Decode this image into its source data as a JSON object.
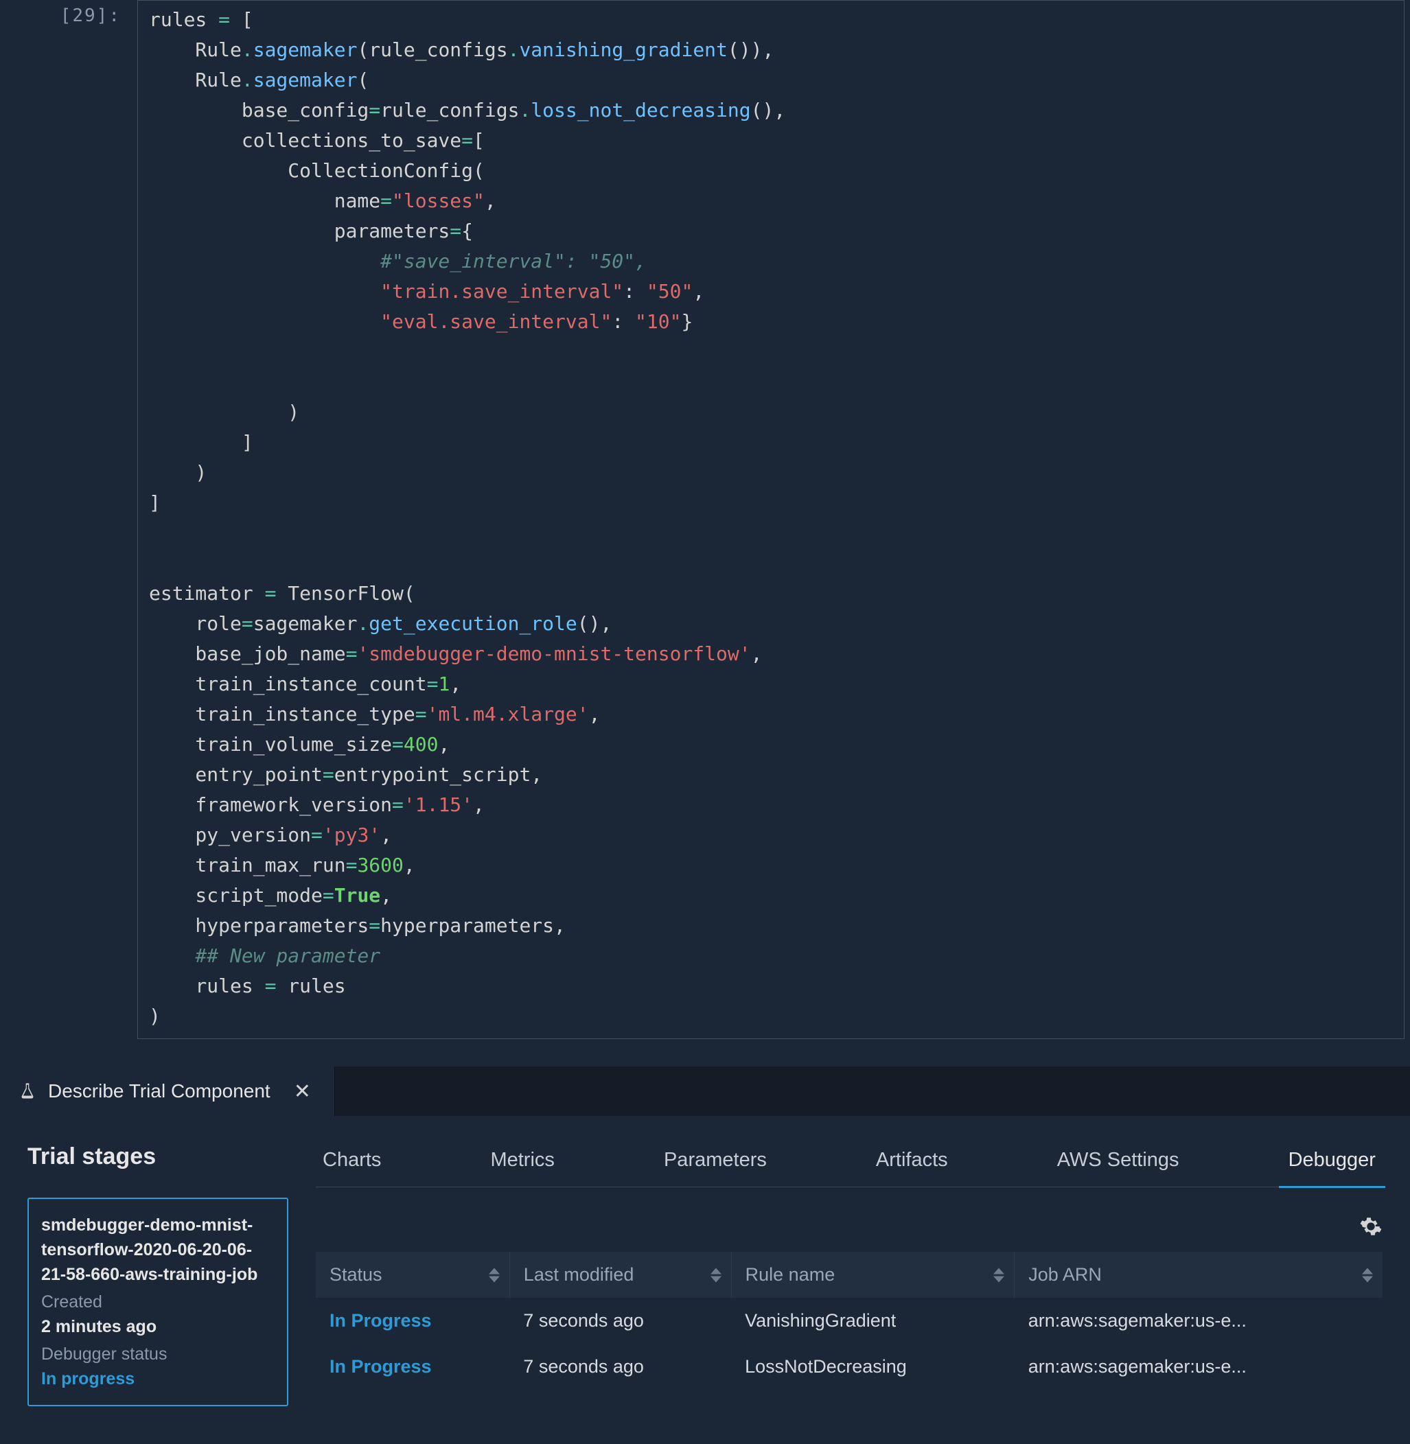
{
  "cell": {
    "prompt": "[29]:",
    "code": {
      "l1a": "rules ",
      "l1b": "=",
      "l1c": " [",
      "l2a": "    Rule",
      "l2b": ".",
      "l2c": "sagemaker",
      "l2d": "(rule_configs",
      "l2e": ".",
      "l2f": "vanishing_gradient",
      "l2g": "()),",
      "l3a": "    Rule",
      "l3b": ".",
      "l3c": "sagemaker",
      "l3d": "(",
      "l4a": "        base_config",
      "l4b": "=",
      "l4c": "rule_configs",
      "l4d": ".",
      "l4e": "loss_not_decreasing",
      "l4f": "(),",
      "l5a": "        collections_to_save",
      "l5b": "=",
      "l5c": "[",
      "l6a": "            CollectionConfig(",
      "l7a": "                name",
      "l7b": "=",
      "l7c": "\"losses\"",
      "l7d": ",",
      "l8a": "                parameters",
      "l8b": "=",
      "l8c": "{",
      "l9a": "                    #\"save_interval\": \"50\",",
      "l10a": "                    ",
      "l10b": "\"train.save_interval\"",
      "l10c": ": ",
      "l10d": "\"50\"",
      "l10e": ",",
      "l11a": "                    ",
      "l11b": "\"eval.save_interval\"",
      "l11c": ": ",
      "l11d": "\"10\"",
      "l11e": "}",
      "l12": "",
      "l13": "",
      "l14": "            )",
      "l15": "        ]",
      "l16": "    )",
      "l17": "]",
      "l18": "",
      "l19": "",
      "l20a": "estimator ",
      "l20b": "=",
      "l20c": " TensorFlow(",
      "l21a": "    role",
      "l21b": "=",
      "l21c": "sagemaker",
      "l21d": ".",
      "l21e": "get_execution_role",
      "l21f": "(),",
      "l22a": "    base_job_name",
      "l22b": "=",
      "l22c": "'smdebugger-demo-mnist-tensorflow'",
      "l22d": ",",
      "l23a": "    train_instance_count",
      "l23b": "=",
      "l23c": "1",
      "l23d": ",",
      "l24a": "    train_instance_type",
      "l24b": "=",
      "l24c": "'ml.m4.xlarge'",
      "l24d": ",",
      "l25a": "    train_volume_size",
      "l25b": "=",
      "l25c": "400",
      "l25d": ",",
      "l26a": "    entry_point",
      "l26b": "=",
      "l26c": "entrypoint_script,",
      "l27a": "    framework_version",
      "l27b": "=",
      "l27c": "'1.15'",
      "l27d": ",",
      "l28a": "    py_version",
      "l28b": "=",
      "l28c": "'py3'",
      "l28d": ",",
      "l29a": "    train_max_run",
      "l29b": "=",
      "l29c": "3600",
      "l29d": ",",
      "l30a": "    script_mode",
      "l30b": "=",
      "l30c": "True",
      "l30d": ",",
      "l31a": "    hyperparameters",
      "l31b": "=",
      "l31c": "hyperparameters,",
      "l32a": "    ## New parameter",
      "l33a": "    rules ",
      "l33b": "=",
      "l33c": " rules",
      "l34": ")"
    }
  },
  "panel": {
    "tab_title": "Describe Trial Component",
    "sidebar": {
      "heading": "Trial stages",
      "card": {
        "title": "smdebugger-demo-mnist-tensorflow-2020-06-20-06-21-58-660-aws-training-job",
        "created_label": "Created",
        "created_value": "2 minutes ago",
        "dbg_label": "Debugger status",
        "dbg_value": "In progress"
      }
    },
    "tabs": [
      "Charts",
      "Metrics",
      "Parameters",
      "Artifacts",
      "AWS Settings",
      "Debugger"
    ],
    "active_tab": "Debugger",
    "table": {
      "headers": [
        "Status",
        "Last modified",
        "Rule name",
        "Job ARN"
      ],
      "rows": [
        {
          "status": "In Progress",
          "modified": "7 seconds ago",
          "rule": "VanishingGradient",
          "arn": "arn:aws:sagemaker:us-e..."
        },
        {
          "status": "In Progress",
          "modified": "7 seconds ago",
          "rule": "LossNotDecreasing",
          "arn": "arn:aws:sagemaker:us-e..."
        }
      ]
    }
  }
}
